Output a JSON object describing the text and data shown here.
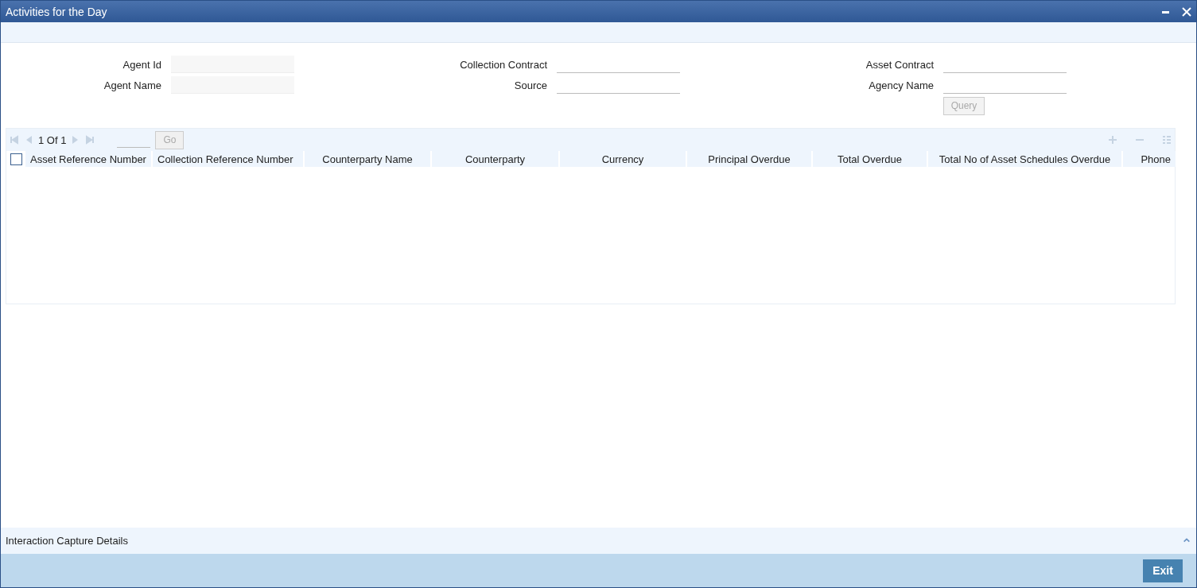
{
  "window": {
    "title": "Activities for the Day"
  },
  "form": {
    "columns": [
      {
        "fields": [
          {
            "label": "Agent Id",
            "disabled": true
          },
          {
            "label": "Agent Name",
            "disabled": true
          }
        ]
      },
      {
        "fields": [
          {
            "label": "Collection Contract",
            "disabled": false
          },
          {
            "label": "Source",
            "disabled": false
          }
        ]
      },
      {
        "fields": [
          {
            "label": "Asset Contract",
            "disabled": false
          },
          {
            "label": "Agency Name",
            "disabled": false
          }
        ]
      }
    ],
    "query_button": "Query"
  },
  "grid": {
    "pager": {
      "text": "1 Of 1",
      "go": "Go"
    },
    "select_all": {
      "checked": false
    },
    "columns": [
      "Asset Reference Number",
      "Collection Reference Number",
      "Counterparty Name",
      "Counterparty",
      "Currency",
      "Principal Overdue",
      "Total Overdue",
      "Total No of Asset Schedules Overdue",
      "Phone"
    ]
  },
  "footer": {
    "section": "Interaction Capture Details",
    "exit": "Exit"
  }
}
